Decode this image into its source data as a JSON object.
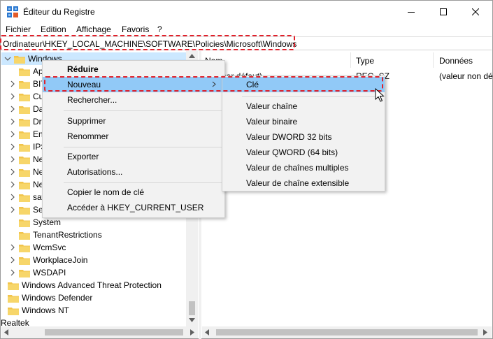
{
  "window": {
    "title": "Éditeur du Registre",
    "controls": [
      "minimize",
      "maximize",
      "close"
    ]
  },
  "menubar": {
    "items": [
      "Fichier",
      "Edition",
      "Affichage",
      "Favoris",
      "?"
    ]
  },
  "address": {
    "path": "Ordinateur\\HKEY_LOCAL_MACHINE\\SOFTWARE\\Policies\\Microsoft\\Windows"
  },
  "tree": {
    "selected": "Windows",
    "children": [
      "Ap",
      "BIT",
      "Cu",
      "Da",
      "Dri",
      "En",
      "IPS",
      "Ne",
      "Ne",
      "Ne",
      "saf",
      "Set",
      "System",
      "TenantRestrictions",
      "WcmSvc",
      "WorkplaceJoin",
      "WSDAPI"
    ],
    "siblings": [
      "Windows Advanced Threat Protection",
      "Windows Defender",
      "Windows NT"
    ],
    "bottom": "Realtek"
  },
  "list": {
    "columns": [
      "Nom",
      "Type",
      "Données"
    ],
    "rows": [
      {
        "name": "(par défaut)",
        "type": "REG_SZ",
        "data": "(valeur non dé"
      }
    ]
  },
  "context_menu": {
    "items": [
      {
        "label": "Réduire",
        "bold": true
      },
      {
        "label": "Nouveau",
        "submenu": true,
        "hover": true
      },
      {
        "label": "Rechercher..."
      },
      {
        "label": "Supprimer"
      },
      {
        "label": "Renommer"
      },
      {
        "label": "Exporter"
      },
      {
        "label": "Autorisations..."
      },
      {
        "label": "Copier le nom de clé"
      },
      {
        "label": "Accéder à HKEY_CURRENT_USER"
      }
    ]
  },
  "submenu": {
    "items": [
      {
        "label": "Clé",
        "hover": true
      },
      {
        "label": "Valeur chaîne"
      },
      {
        "label": "Valeur binaire"
      },
      {
        "label": "Valeur DWORD 32 bits"
      },
      {
        "label": "Valeur QWORD (64 bits)"
      },
      {
        "label": "Valeur de chaînes multiples"
      },
      {
        "label": "Valeur de chaîne extensible"
      }
    ]
  },
  "colors": {
    "highlight": "#91c9f7",
    "selected": "#cce8ff",
    "annotation": "#e0202a",
    "folder": "#f2c44b"
  }
}
